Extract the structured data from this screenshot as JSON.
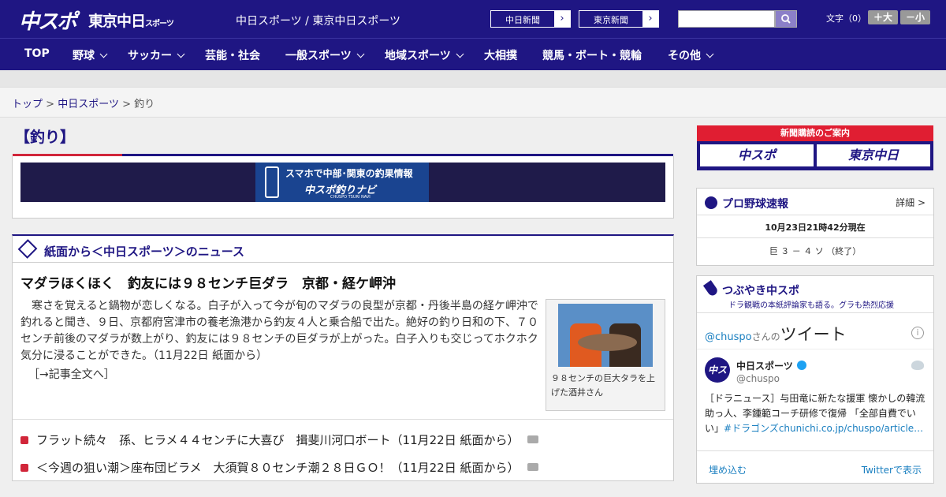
{
  "header": {
    "logo_chuspo": "中スポ",
    "logo_tokyo": "東京中日",
    "logo_tokyo_small": "スポーツ",
    "site_title": "中日スポーツ / 東京中日スポーツ",
    "ext_links": [
      {
        "label": "中日新聞",
        "arrow": "›"
      },
      {
        "label": "東京新聞",
        "arrow": "›"
      }
    ],
    "search_value": "",
    "font_size_label": "文字（0）",
    "font_increase": "＋大",
    "font_decrease": "－小"
  },
  "nav": {
    "items": [
      "TOP",
      "野球",
      "サッカー",
      "芸能・社会",
      "一般スポーツ",
      "地域スポーツ",
      "大相撲",
      "競馬・ボート・競輪",
      "その他"
    ]
  },
  "breadcrumb": {
    "top": "トップ",
    "sep": ">",
    "section": "中日スポーツ",
    "current": "釣り"
  },
  "page_title": "【釣り】",
  "banner": {
    "line1": "スマホで中部･関東の釣果情報",
    "line2": "中スポ釣りナビ",
    "line3": "CHUSPO TSURI NAVI"
  },
  "news": {
    "section_heading": "紙面から＜中日スポーツ＞のニュース",
    "headline": "マダラほくほく　釣友には９８センチ巨ダラ　京都・経ケ岬沖",
    "body": "寒さを覚えると鍋物が恋しくなる。白子が入って今が旬のマダラの良型が京都・丹後半島の経ケ岬沖で釣れると聞き、９日、京都府宮津市の養老漁港から釣友４人と乗合船で出た。絶好の釣り日和の下、７０センチ前後のマダラが数上がり、釣友には９８センチの巨ダラが上がった。白子入りも交じってホクホク気分に浸ることができた。（11月22日 紙面から）",
    "more": "［→記事全文へ］",
    "photo_caption": "９８センチの巨大タラを上げた酒井さん",
    "list": [
      "フラット続々　孫、ヒラメ４４センチに大喜び　揖斐川河口ボート（11月22日 紙面から）",
      "＜今週の狙い潮＞座布団ビラメ　大須賀８０センチ潮２８日ＧＯ！（11月22日 紙面から）"
    ]
  },
  "sidebar": {
    "subscribe": {
      "heading": "新聞購読のご案内",
      "chuspo": "中スポ",
      "tokyo": "東京中日"
    },
    "baseball": {
      "title": "プロ野球速報",
      "more": "詳細 >",
      "time": "10月23日21時42分現在",
      "score": "巨 ３ － ４ ソ （終了）"
    },
    "tweets": {
      "title": "つぶやき中スポ",
      "subtitle": "ドラ観戦の本紙評論家も語る。グラも熱烈応援",
      "handle": "@chuspo",
      "handle_suffix": "さんの",
      "tweets_label": "ツイート",
      "info": "i",
      "avatar_text": "中スポ",
      "account_name": "中日スポーツ",
      "account_id": "@chuspo",
      "tweet_text": "［ドラニュース］与田竜に新たな援軍 懐かしの韓流助っ人、李鍾範コーチ研修で復帰 「全部自費でい い」",
      "tweet_hashtag": "#ドラゴンズchunichi.co.jp/chuspo/article…",
      "embed": "埋め込む",
      "view_on_twitter": "Twitterで表示"
    }
  }
}
